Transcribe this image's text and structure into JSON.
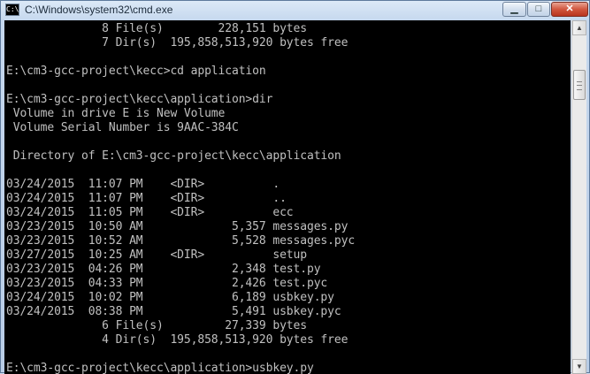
{
  "window": {
    "title": "C:\\Windows\\system32\\cmd.exe",
    "icon": "cmd-icon",
    "icon_glyph": "C:\\",
    "controls": {
      "minimize_glyph": "▁",
      "maximize_glyph": "□",
      "close_glyph": "✕"
    }
  },
  "console": {
    "lines": [
      "              8 File(s)        228,151 bytes",
      "              7 Dir(s)  195,858,513,920 bytes free",
      "",
      "E:\\cm3-gcc-project\\kecc>cd application",
      "",
      "E:\\cm3-gcc-project\\kecc\\application>dir",
      " Volume in drive E is New Volume",
      " Volume Serial Number is 9AAC-384C",
      "",
      " Directory of E:\\cm3-gcc-project\\kecc\\application",
      "",
      "03/24/2015  11:07 PM    <DIR>          .",
      "03/24/2015  11:07 PM    <DIR>          ..",
      "03/24/2015  11:05 PM    <DIR>          ecc",
      "03/23/2015  10:50 AM             5,357 messages.py",
      "03/23/2015  10:52 AM             5,528 messages.pyc",
      "03/27/2015  10:25 AM    <DIR>          setup",
      "03/23/2015  04:26 PM             2,348 test.py",
      "03/23/2015  04:33 PM             2,426 test.pyc",
      "03/24/2015  10:02 PM             6,189 usbkey.py",
      "03/24/2015  08:38 PM             5,491 usbkey.pyc",
      "              6 File(s)         27,339 bytes",
      "              4 Dir(s)  195,858,513,920 bytes free",
      "",
      "E:\\cm3-gcc-project\\kecc\\application>usbkey.py"
    ]
  },
  "scrollbar": {
    "up_glyph": "▲",
    "down_glyph": "▼"
  }
}
